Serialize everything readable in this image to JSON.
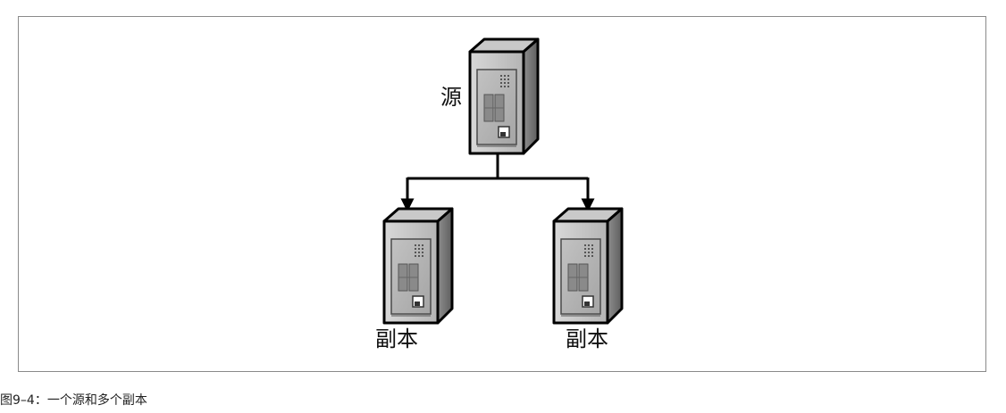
{
  "diagram": {
    "source_label": "源",
    "replica_label_1": "副本",
    "replica_label_2": "副本"
  },
  "caption": "图9–4：一个源和多个副本",
  "icons": {
    "server": "server-tower-icon"
  }
}
